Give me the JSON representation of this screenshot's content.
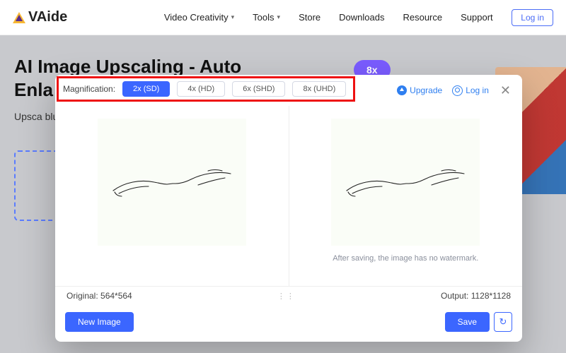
{
  "brand": "VAide",
  "nav": {
    "items": [
      {
        "label": "Video Creativity",
        "caret": true
      },
      {
        "label": "Tools",
        "caret": true
      },
      {
        "label": "Store",
        "caret": false
      },
      {
        "label": "Downloads",
        "caret": false
      },
      {
        "label": "Resource",
        "caret": false
      },
      {
        "label": "Support",
        "caret": false
      }
    ],
    "login": "Log in"
  },
  "hero": {
    "title_l1": "AI Image Upscaling - Auto",
    "title_l2": "Enla",
    "sub": "Upsca\nblurry",
    "pill": "8x"
  },
  "modal": {
    "mag_label": "Magnification:",
    "options": [
      {
        "label": "2x (SD)",
        "active": true
      },
      {
        "label": "4x (HD)",
        "active": false
      },
      {
        "label": "6x (SHD)",
        "active": false
      },
      {
        "label": "8x (UHD)",
        "active": false
      }
    ],
    "upgrade": "Upgrade",
    "login": "Log in",
    "watermark": "After saving, the image has no watermark.",
    "original": "Original: 564*564",
    "output": "Output: 1128*1128",
    "new_image": "New Image",
    "save": "Save"
  }
}
